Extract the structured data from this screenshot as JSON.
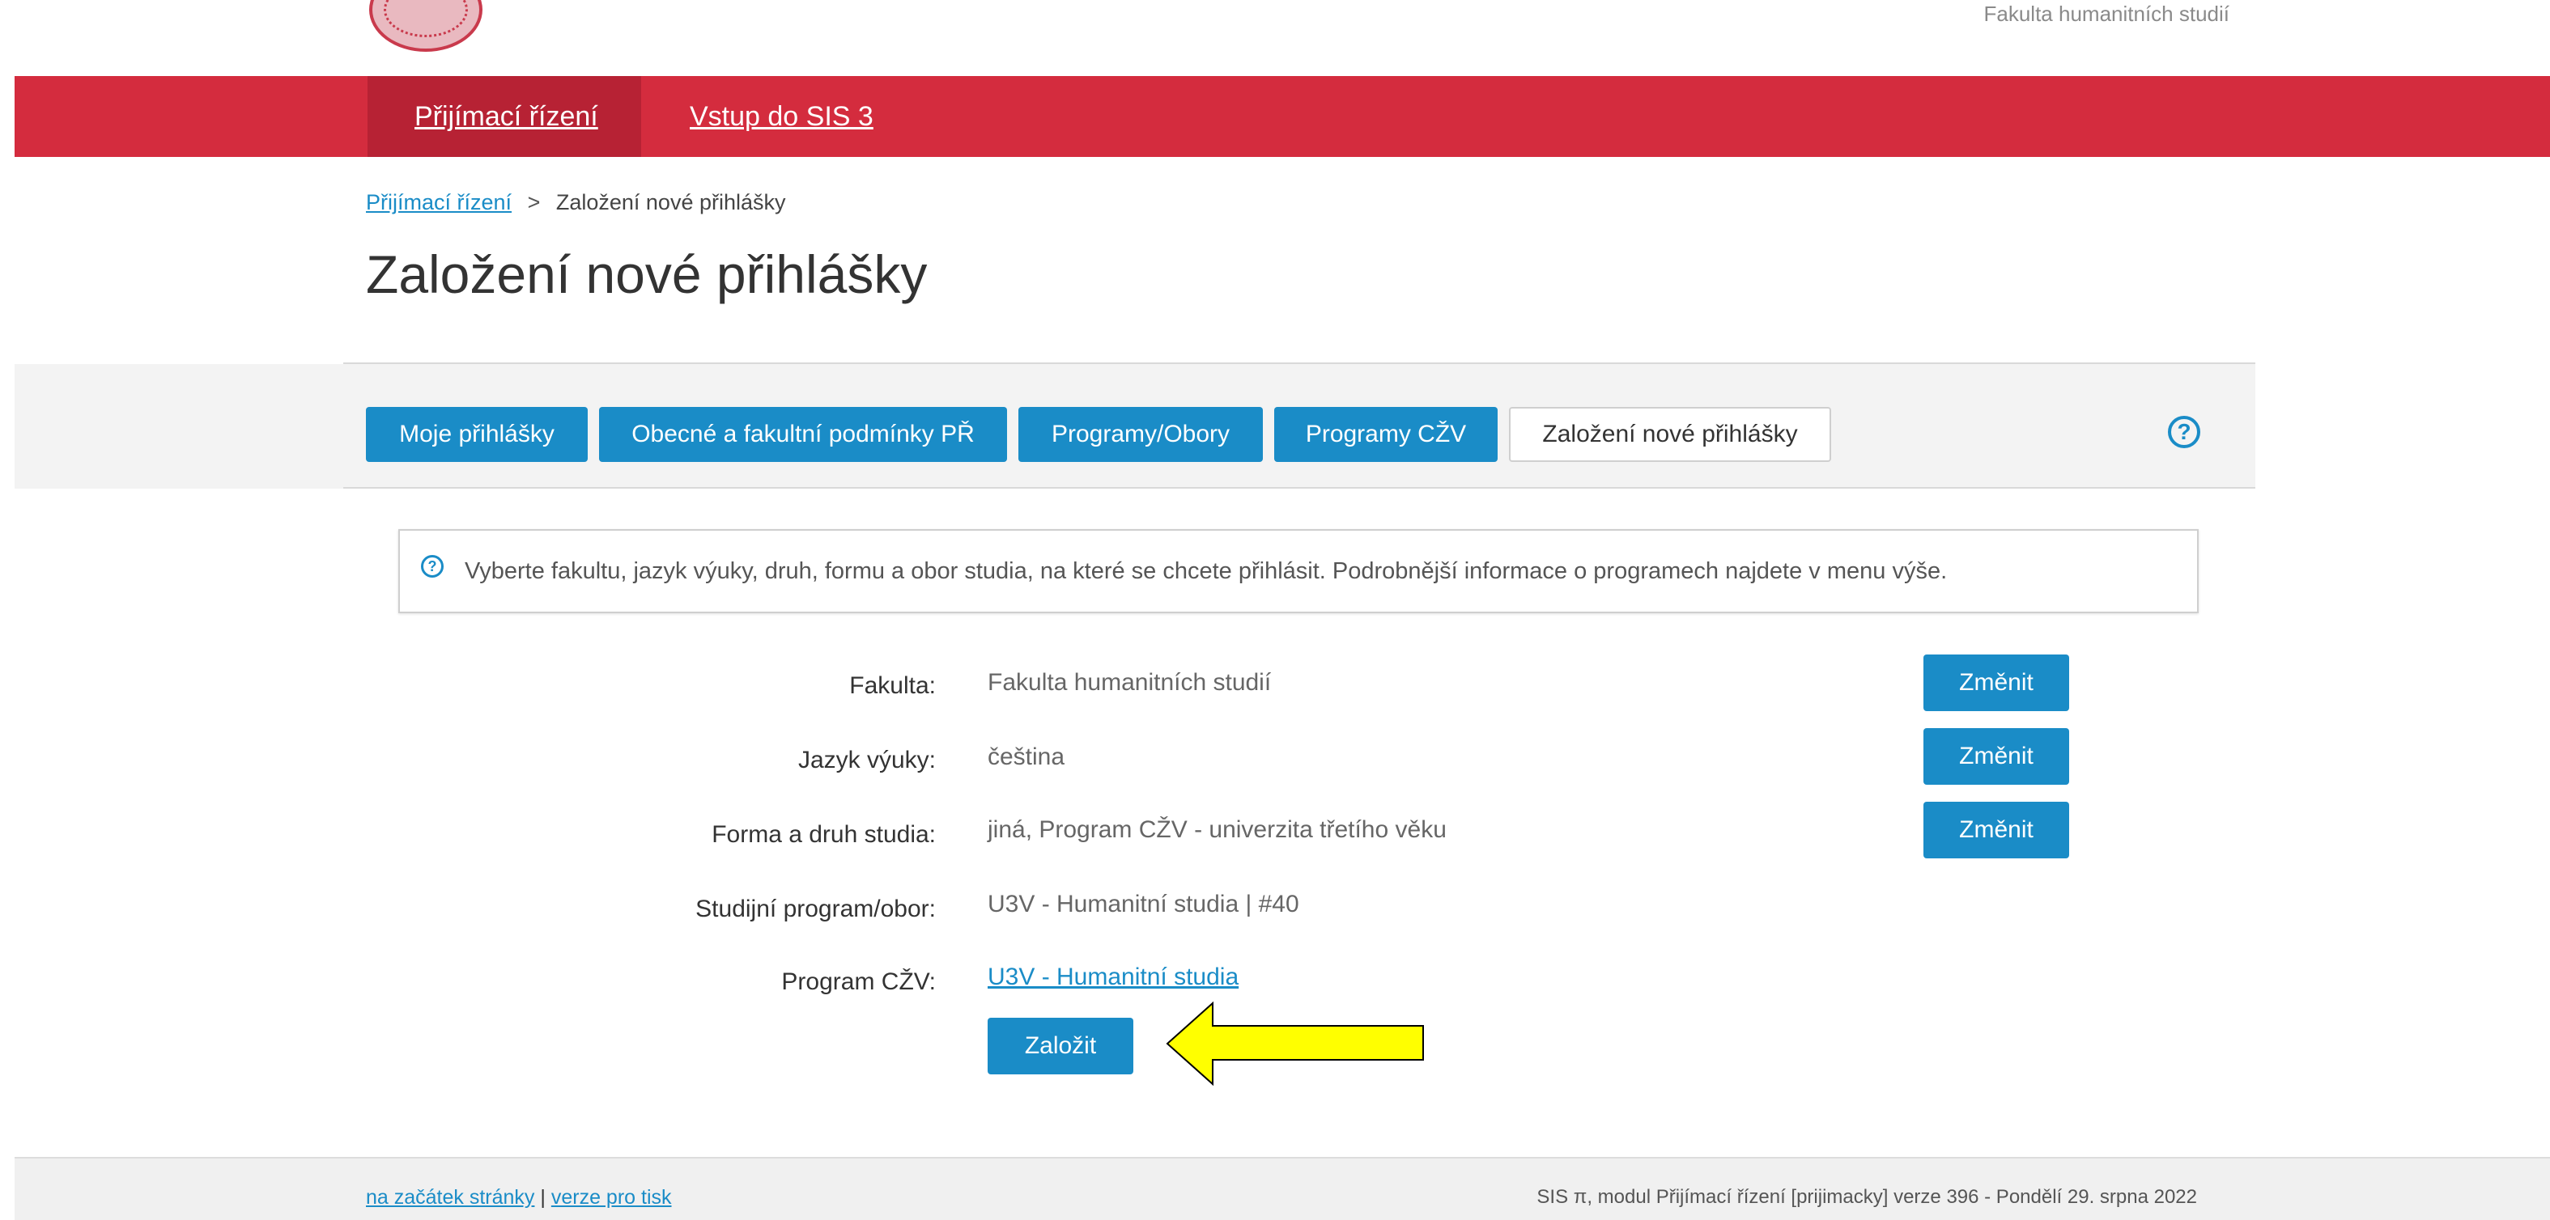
{
  "header": {
    "faculty_name": "Fakulta humanitních studií",
    "nav": [
      "Přijímací řízení",
      "Vstup do SIS 3"
    ]
  },
  "breadcrumb": {
    "link": "Přijímací řízení",
    "separator": ">",
    "current": "Založení nové přihlášky"
  },
  "page_title": "Založení nové přihlášky",
  "tabs": [
    "Moje přihlášky",
    "Obecné a fakultní podmínky PŘ",
    "Programy/Obory",
    "Programy CŽV",
    "Založení nové přihlášky"
  ],
  "help_icon": "?",
  "info": {
    "icon": "?",
    "text": "Vyberte fakultu, jazyk výuky, druh, formu a obor studia, na které se chcete přihlásit. Podrobnější informace o programech najdete v menu výše."
  },
  "form": {
    "rows": [
      {
        "label": "Fakulta:",
        "value": "Fakulta humanitních studií",
        "button": "Změnit"
      },
      {
        "label": "Jazyk výuky:",
        "value": "čeština",
        "button": "Změnit"
      },
      {
        "label": "Forma a druh studia:",
        "value": "jiná, Program CŽV - univerzita třetího věku",
        "button": "Změnit"
      },
      {
        "label": "Studijní program/obor:",
        "value": "U3V - Humanitní studia | #40"
      },
      {
        "label": "Program CŽV:",
        "value": "U3V - Humanitní studia"
      }
    ],
    "submit_label": "Založit"
  },
  "footer": {
    "link_top": "na začátek stránky",
    "divider": "|",
    "link_print": "verze pro tisk",
    "version": "SIS π, modul Přijímací řízení [prijimacky] verze 396 - Pondělí 29. srpna 2022"
  },
  "colors": {
    "brand_red": "#d42c3e",
    "brand_red_dark": "#b72234",
    "accent_blue": "#1a8cc7",
    "arrow_yellow": "#ffff00"
  }
}
